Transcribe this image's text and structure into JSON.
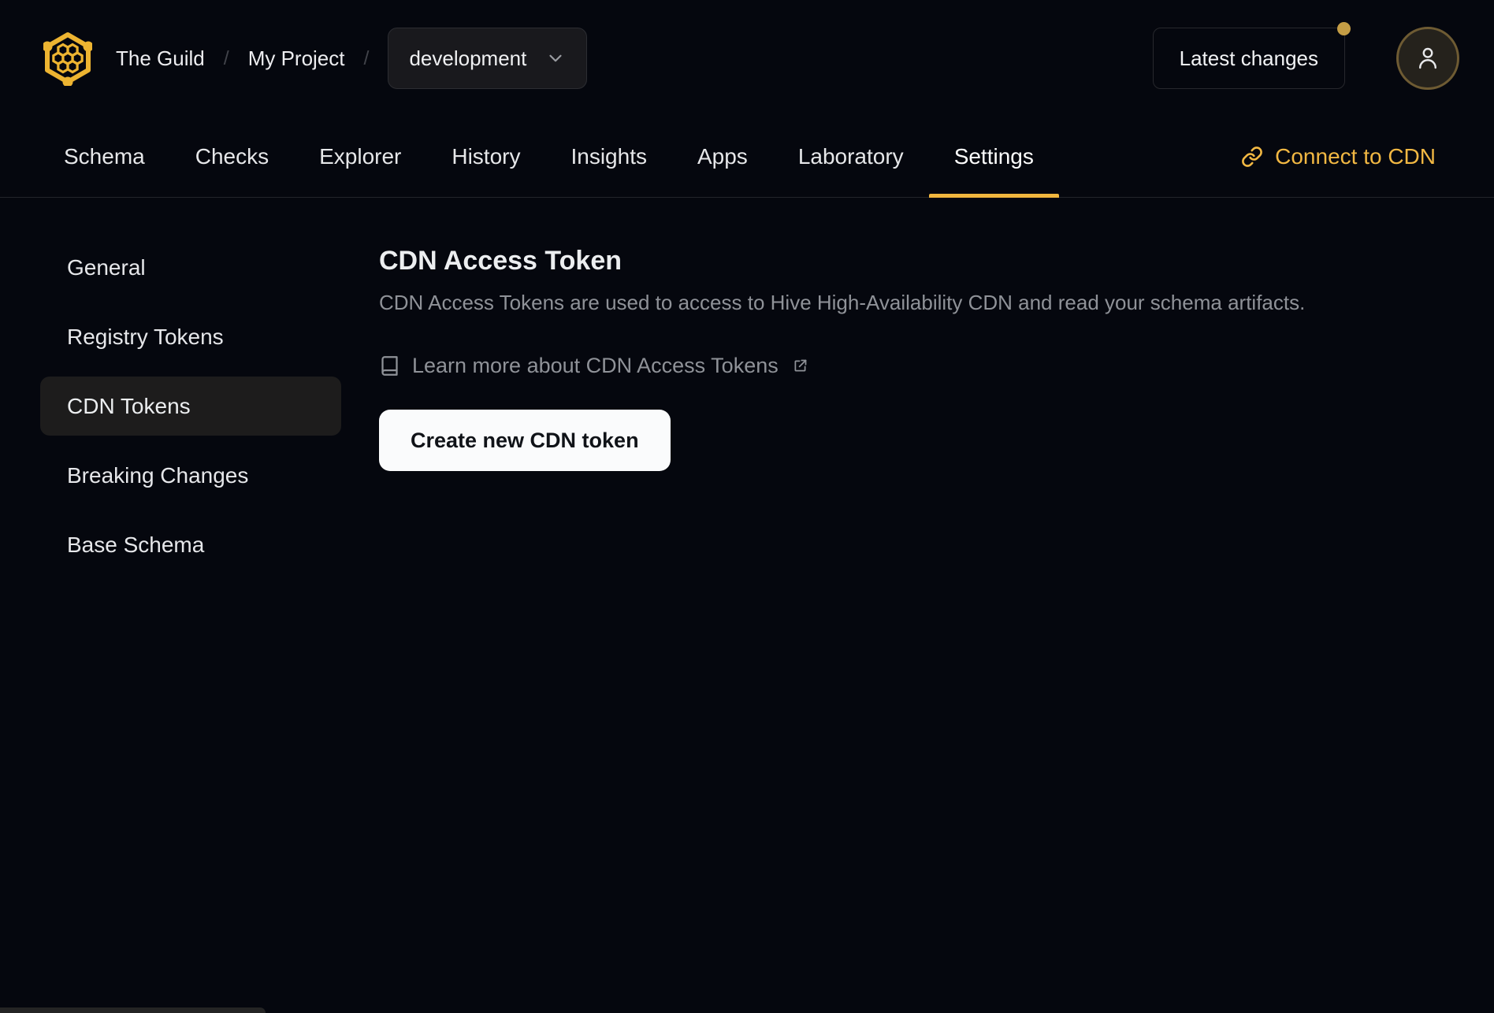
{
  "colors": {
    "accent_gold": "#f4b740",
    "page_background": "#05070e",
    "active_item_background": "#1d1c1c",
    "primary_button_background": "#fafbfc",
    "primary_button_text": "#101318",
    "muted_text": "#8f9298",
    "notification_dot": "#c49d45",
    "avatar_ring": "#6e5b33"
  },
  "header": {
    "breadcrumb": {
      "org": "The Guild",
      "separator": "/",
      "project": "My Project",
      "target": "development"
    },
    "latest_changes_label": "Latest changes"
  },
  "nav": {
    "tabs": [
      {
        "label": "Schema"
      },
      {
        "label": "Checks"
      },
      {
        "label": "Explorer"
      },
      {
        "label": "History"
      },
      {
        "label": "Insights"
      },
      {
        "label": "Apps"
      },
      {
        "label": "Laboratory"
      },
      {
        "label": "Settings",
        "active": true
      }
    ],
    "connect_cdn_label": "Connect to CDN"
  },
  "sidebar": {
    "items": [
      {
        "label": "General"
      },
      {
        "label": "Registry Tokens"
      },
      {
        "label": "CDN Tokens",
        "active": true
      },
      {
        "label": "Breaking Changes"
      },
      {
        "label": "Base Schema"
      }
    ]
  },
  "main": {
    "title": "CDN Access Token",
    "description": "CDN Access Tokens are used to access to Hive High-Availability CDN and read your schema artifacts.",
    "learn_more_label": "Learn more about CDN Access Tokens",
    "create_button_label": "Create new CDN token"
  },
  "icons": {
    "logo": "hive-hexagon-logo",
    "target_selector": "chevron-down-icon",
    "user": "user-icon",
    "connect_cdn": "link-icon",
    "learn_more": "book-icon",
    "external": "external-link-icon"
  }
}
